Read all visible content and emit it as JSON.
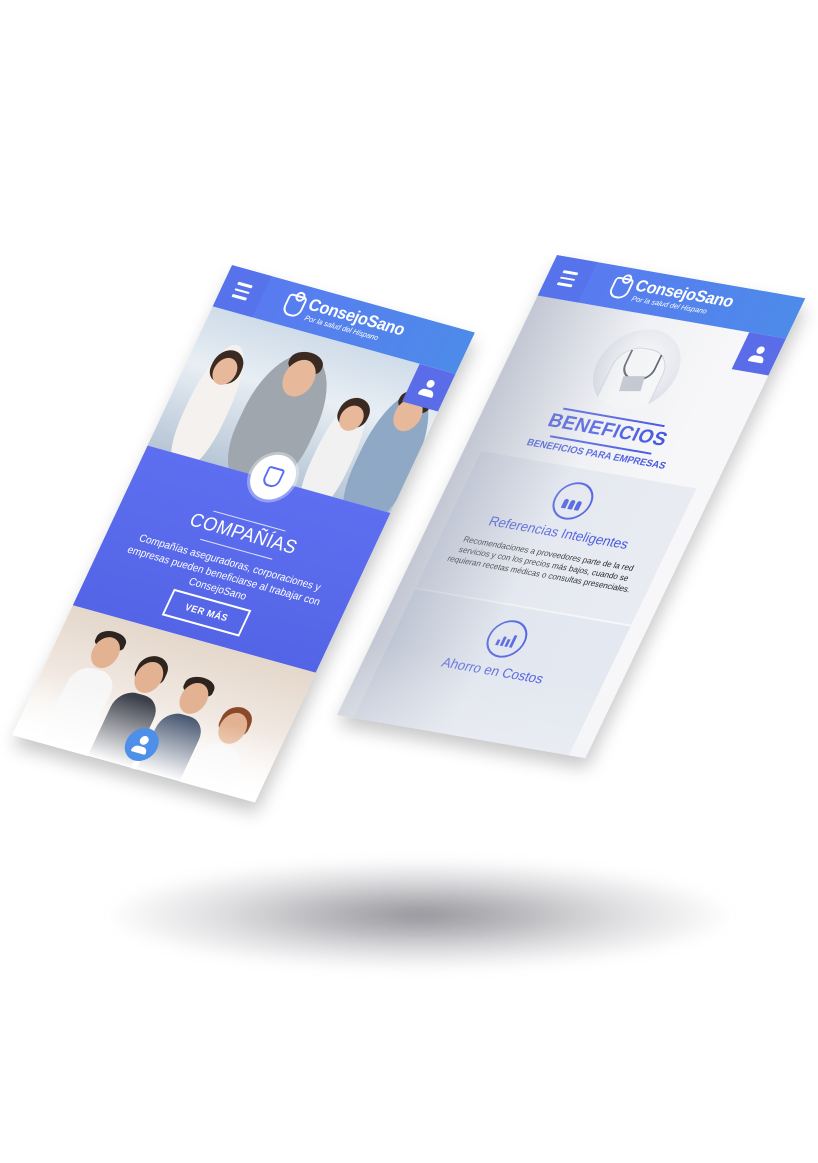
{
  "brand": {
    "name": "ConsejoSano",
    "tagline": "Por la salud del Hispano"
  },
  "left_screen": {
    "hero": {
      "title": "COMPAÑÍAS",
      "text": "Compañías aseguradoras, corporaciones y empresas pueden beneficiarse al trabajar con ConsejoSano",
      "button_label": "VER MÁS"
    }
  },
  "right_screen": {
    "section_title": "BENEFICIOS",
    "section_subtitle": "BENEFICIOS PARA EMPRESAS",
    "cards": [
      {
        "icon": "people-icon",
        "title": "Referencias Inteligentes",
        "text": "Recomendaciones a proveedores parte de la red servicios y con los precios más bajos, cuando se requieran recetas médicas o consultas presenciales."
      },
      {
        "icon": "bar-chart-icon",
        "title": "Ahorro en Costos"
      }
    ]
  },
  "colors": {
    "primary": "#5b6ff0",
    "accent_blue": "#3c4fe0",
    "light_blue": "#4d8be9"
  }
}
